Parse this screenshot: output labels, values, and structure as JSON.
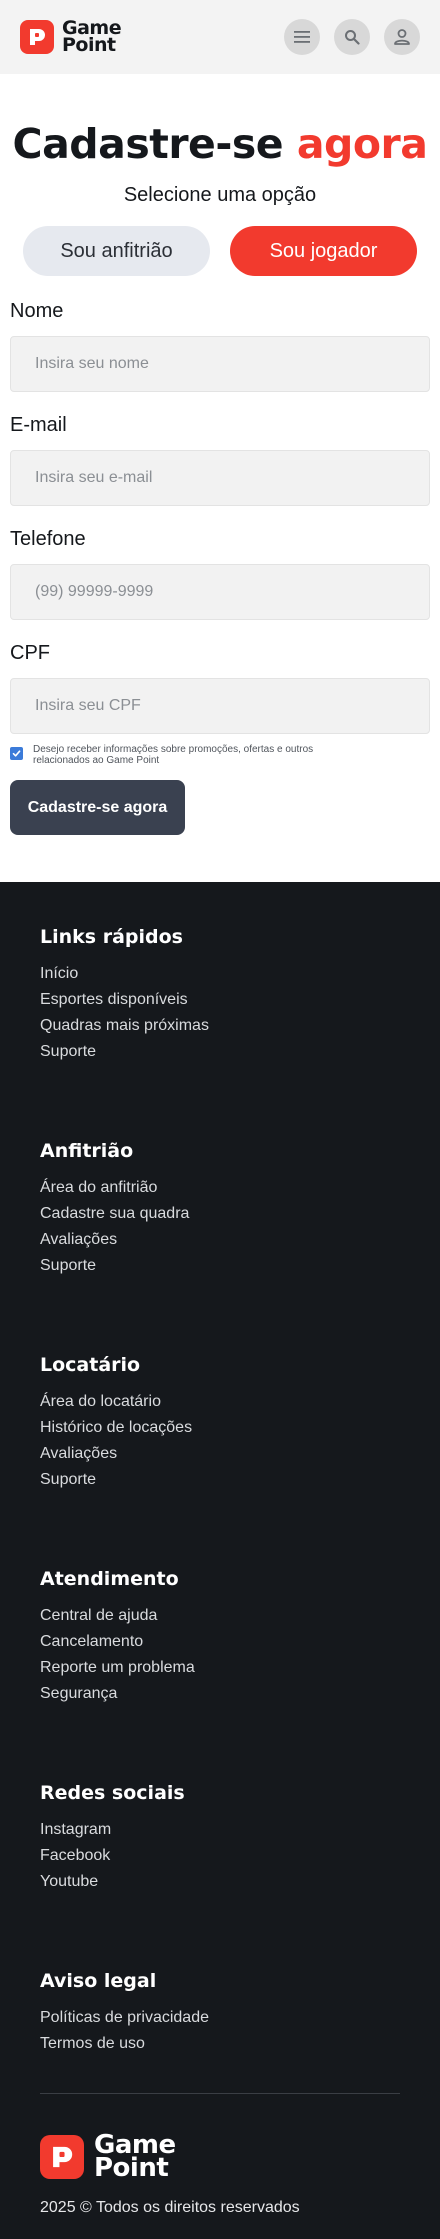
{
  "header": {
    "logo_line1": "Game",
    "logo_line2": "Point",
    "icons": [
      "menu-icon",
      "search-icon",
      "user-icon"
    ]
  },
  "main": {
    "title": "Cadastre-se",
    "title_accent": "agora",
    "subtitle": "Selecione uma opção",
    "toggle": {
      "host_label": "Sou anfitrião",
      "player_label": "Sou jogador",
      "selected": "player"
    },
    "fields": {
      "name": {
        "label": "Nome",
        "placeholder": "Insira seu nome",
        "value": ""
      },
      "email": {
        "label": "E-mail",
        "placeholder": "Insira seu e-mail",
        "value": ""
      },
      "phone": {
        "label": "Telefone",
        "placeholder": "(99) 99999-9999",
        "value": ""
      },
      "cpf": {
        "label": "CPF",
        "placeholder": "Insira seu CPF",
        "value": ""
      }
    },
    "consent": {
      "checked": true,
      "text": "Desejo receber informações sobre promoções, ofertas e outros relacionados ao Game Point"
    },
    "submit_label": "Cadastre-se agora"
  },
  "footer": {
    "sections": [
      {
        "title": "Links rápidos",
        "links": [
          "Início",
          "Esportes disponíveis",
          "Quadras mais próximas",
          "Suporte"
        ]
      },
      {
        "title": "Anfitrião",
        "links": [
          "Área do anfitrião",
          "Cadastre sua quadra",
          "Avaliações",
          "Suporte"
        ]
      },
      {
        "title": "Locatário",
        "links": [
          "Área do locatário",
          "Histórico de locações",
          "Avaliações",
          "Suporte"
        ]
      },
      {
        "title": "Atendimento",
        "links": [
          "Central de ajuda",
          "Cancelamento",
          "Reporte um problema",
          "Segurança"
        ]
      },
      {
        "title": "Redes sociais",
        "links": [
          "Instagram",
          "Facebook",
          "Youtube"
        ]
      },
      {
        "title": "Aviso legal",
        "links": [
          "Políticas de privacidade",
          "Termos de uso"
        ]
      }
    ],
    "logo_line1": "Game",
    "logo_line2": "Point",
    "copyright": "2025 © Todos os direitos reservados"
  },
  "colors": {
    "brand_red": "#f23a2e",
    "dark": "#15181c",
    "button_dark": "#3a4150",
    "checkbox_blue": "#3b7bd9"
  }
}
